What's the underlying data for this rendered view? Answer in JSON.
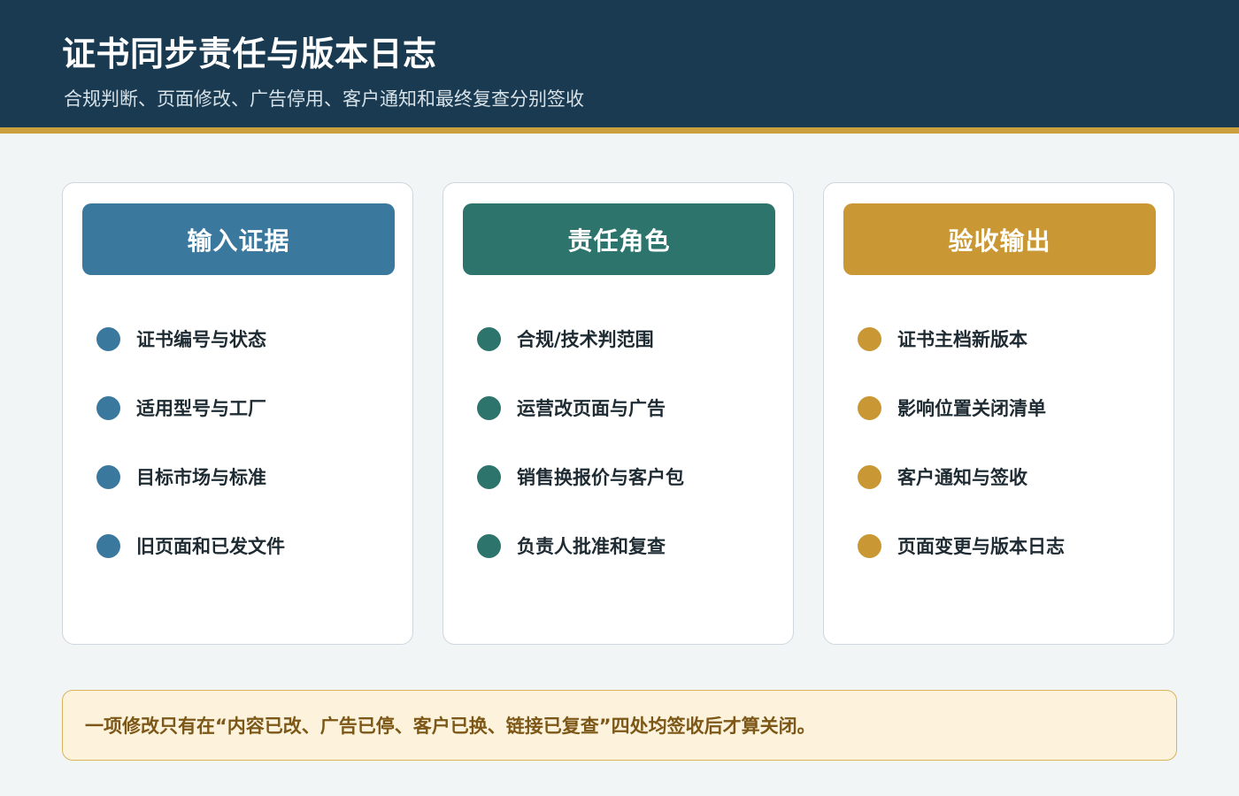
{
  "header": {
    "title": "证书同步责任与版本日志",
    "subtitle": "合规判断、页面修改、广告停用、客户通知和最终复查分别签收"
  },
  "columns": [
    {
      "title": "输入证据",
      "color": "#3b789e",
      "items": [
        "证书编号与状态",
        "适用型号与工厂",
        "目标市场与标准",
        "旧页面和已发文件"
      ]
    },
    {
      "title": "责任角色",
      "color": "#2c746c",
      "items": [
        "合规/技术判范围",
        "运营改页面与广告",
        "销售换报价与客户包",
        "负责人批准和复查"
      ]
    },
    {
      "title": "验收输出",
      "color": "#c99834",
      "items": [
        "证书主档新版本",
        "影响位置关闭清单",
        "客户通知与签收",
        "页面变更与版本日志"
      ]
    }
  ],
  "note": {
    "text": "一项修改只有在“内容已改、广告已停、客户已换、链接已复查”四处均签收后才算关闭。"
  }
}
